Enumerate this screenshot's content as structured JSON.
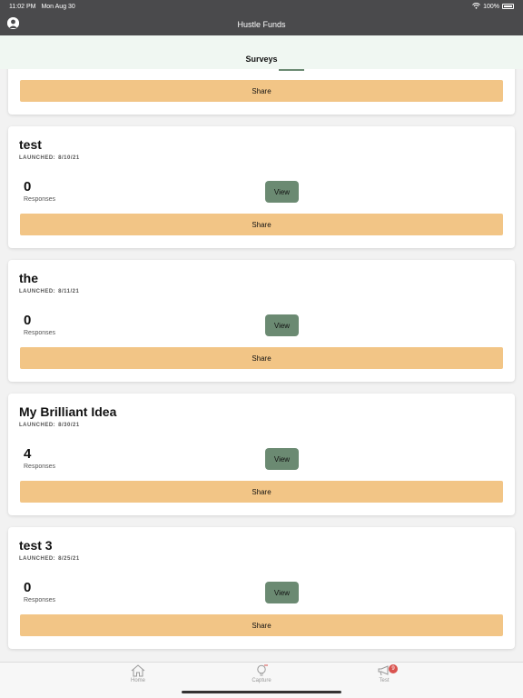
{
  "status_bar": {
    "time": "11:02 PM",
    "date": "Mon Aug 30",
    "battery": "100%"
  },
  "nav": {
    "title": "Hustle Funds"
  },
  "sub_header": {
    "title": "Surveys"
  },
  "share_label": "Share",
  "view_label": "View",
  "responses_label": "Responses",
  "launched_label": "LAUNCHED:",
  "cards": [
    {
      "title": "test",
      "launched": "8/10/21",
      "count": "0"
    },
    {
      "title": "the",
      "launched": "8/11/21",
      "count": "0"
    },
    {
      "title": "My Brilliant Idea",
      "launched": "8/30/21",
      "count": "4"
    },
    {
      "title": "test 3",
      "launched": "8/25/21",
      "count": "0"
    }
  ],
  "tabs": [
    {
      "label": "Home",
      "icon": "home-icon"
    },
    {
      "label": "Capture",
      "icon": "lightbulb-icon"
    },
    {
      "label": "Test",
      "icon": "megaphone-icon",
      "badge": "9"
    }
  ],
  "colors": {
    "share": "#f2c586",
    "view": "#6b8a72",
    "header": "#4a4a4c",
    "badge": "#d9534f"
  }
}
